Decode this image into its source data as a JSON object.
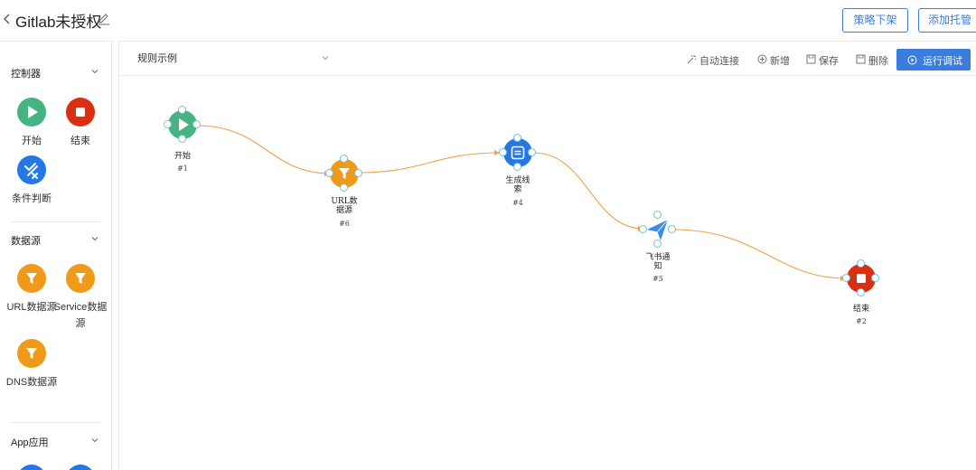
{
  "header": {
    "title": "Gitlab未授权",
    "offline_button": "策略下架",
    "add_button": "添加托管"
  },
  "sidebar": {
    "categories": [
      {
        "label": "控制器",
        "items": [
          {
            "label": "开始",
            "icon": "play-icon"
          },
          {
            "label": "结束",
            "icon": "stop-icon"
          },
          {
            "label": "条件判断",
            "icon": "condition-icon"
          }
        ]
      },
      {
        "label": "数据源",
        "items": [
          {
            "label": "URL数据源",
            "icon": "funnel-icon"
          },
          {
            "label": "Service数据源",
            "icon": "funnel-icon"
          },
          {
            "label": "DNS数据源",
            "icon": "funnel-icon"
          }
        ]
      },
      {
        "label": "App应用",
        "items": []
      }
    ]
  },
  "toolbar": {
    "rule_select_value": "规则示例",
    "auto_connect": "自动连接",
    "add": "新增",
    "save": "保存",
    "delete": "删除",
    "run_debug": "运行调试"
  },
  "flow": {
    "nodes": [
      {
        "label": "开始",
        "id": "#1",
        "type": "start"
      },
      {
        "label": "URL数据源",
        "id": "#6",
        "type": "url-datasource"
      },
      {
        "label": "生成线索",
        "id": "#4",
        "type": "generate-clue"
      },
      {
        "label": "飞书通知",
        "id": "#5",
        "type": "feishu-notify"
      },
      {
        "label": "结束",
        "id": "#2",
        "type": "end"
      }
    ],
    "edges": [
      [
        "#1",
        "#6"
      ],
      [
        "#6",
        "#4"
      ],
      [
        "#4",
        "#5"
      ],
      [
        "#5",
        "#2"
      ]
    ]
  },
  "colors": {
    "start": "#47b383",
    "end": "#d93014",
    "condition": "#2477e4",
    "datasource": "#f09a1a",
    "edge": "#f0a04b",
    "primary": "#3b7ddd",
    "port_border": "#6cc3d6"
  }
}
